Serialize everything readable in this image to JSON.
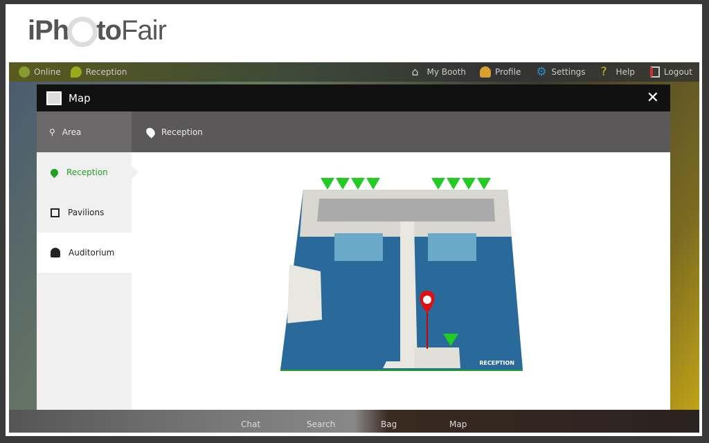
{
  "logo": {
    "text_a": "iPh",
    "text_b": "to",
    "text_c": "Fair"
  },
  "toolbar": {
    "status": {
      "label": "Online",
      "icon": "status-dot-icon",
      "color": "#8a9a30"
    },
    "location": {
      "label": "Reception",
      "icon": "location-bubble-icon"
    },
    "right": [
      {
        "label": "My Booth",
        "icon": "home-icon",
        "color": "#cccccc"
      },
      {
        "label": "Profile",
        "icon": "profile-icon",
        "color": "#d9a030"
      },
      {
        "label": "Settings",
        "icon": "gear-icon",
        "color": "#2a8ad0"
      },
      {
        "label": "Help",
        "icon": "question-icon",
        "color": "#c8c020"
      },
      {
        "label": "Logout",
        "icon": "logout-icon",
        "color": "#d03030"
      }
    ]
  },
  "modal": {
    "title": "Map",
    "close_label": "✕",
    "tabs": [
      {
        "label": "Area",
        "icon": "area-icon"
      },
      {
        "label": "Reception",
        "icon": "pin-icon"
      }
    ],
    "sidebar": [
      {
        "label": "Reception",
        "icon": "pin-icon",
        "state": "selected"
      },
      {
        "label": "Pavilions",
        "icon": "square-icon",
        "state": "normal"
      },
      {
        "label": "Auditorium",
        "icon": "auditorium-icon",
        "state": "hover"
      }
    ],
    "map_label": "RECEPTION",
    "accent": "#22a020"
  },
  "bottom_bar": [
    {
      "label": "Chat"
    },
    {
      "label": "Search"
    },
    {
      "label": "Bag"
    },
    {
      "label": "Map"
    }
  ]
}
